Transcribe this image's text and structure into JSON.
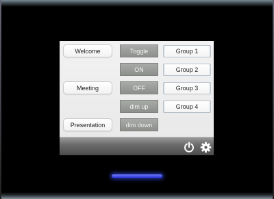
{
  "scenes": {
    "welcome_label": "Welcome",
    "meeting_label": "Meeting",
    "presentation_label": "Presentation"
  },
  "controls": {
    "toggle_label": "Toggle",
    "on_label": "ON",
    "off_label": "OFF",
    "dim_up_label": "dim up",
    "dim_down_label": "dim down"
  },
  "groups": {
    "group1_label": "Group 1",
    "group2_label": "Group 2",
    "group3_label": "Group 3",
    "group4_label": "Group 4"
  },
  "toolbar": {
    "power_icon": "power-icon",
    "settings_icon": "gear-icon"
  },
  "colors": {
    "frame": "#000000",
    "led": "#3a48f0",
    "control_button": "#9a9c99"
  }
}
